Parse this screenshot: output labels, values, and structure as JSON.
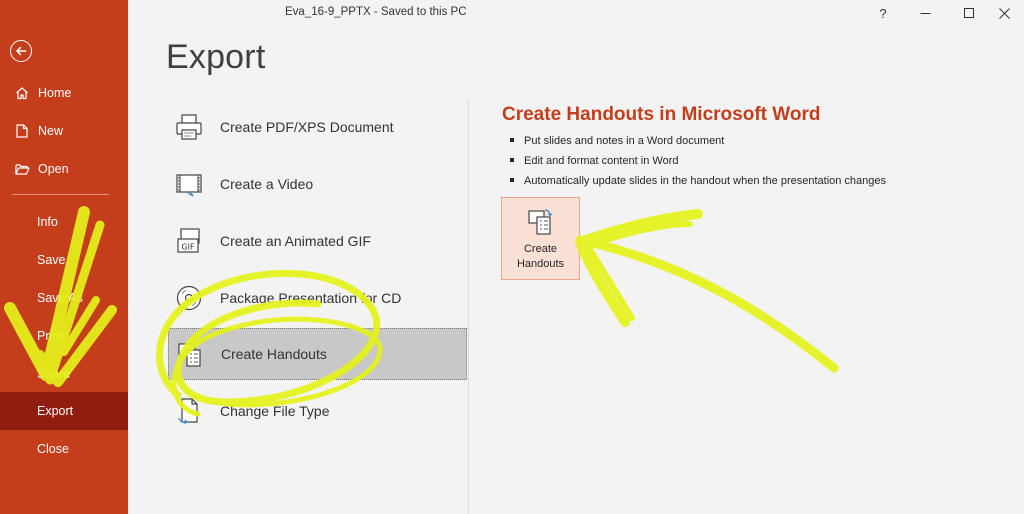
{
  "window": {
    "title": "Eva_16-9_PPTX  -  Saved to this PC",
    "help": "?",
    "minimize": "—",
    "maximize": "☐",
    "close": "✕"
  },
  "sidebar": {
    "back_icon": "back-arrow-icon",
    "items": [
      {
        "label": "Home",
        "icon": "home-icon"
      },
      {
        "label": "New",
        "icon": "new-document-icon"
      },
      {
        "label": "Open",
        "icon": "open-folder-icon"
      },
      {
        "label": "Info"
      },
      {
        "label": "Save"
      },
      {
        "label": "Save As"
      },
      {
        "label": "Print"
      },
      {
        "label": "Share"
      },
      {
        "label": "Export"
      },
      {
        "label": "Close"
      }
    ],
    "active": "Export",
    "bg_color": "#c43e1c",
    "active_color": "#8f1d10"
  },
  "page": {
    "title": "Export"
  },
  "export_options": [
    {
      "label": "Create PDF/XPS Document",
      "icon": "pdf-xps-icon"
    },
    {
      "label": "Create a Video",
      "icon": "video-icon"
    },
    {
      "label": "Create an Animated GIF",
      "icon": "gif-icon"
    },
    {
      "label": "Package Presentation for CD",
      "icon": "cd-icon"
    },
    {
      "label": "Create Handouts",
      "icon": "handouts-icon"
    },
    {
      "label": "Change File Type",
      "icon": "file-type-icon"
    }
  ],
  "selected_option": "Create Handouts",
  "detail": {
    "title": "Create Handouts in Microsoft Word",
    "bullets": [
      "Put slides and notes in a Word document",
      "Edit and format content in Word",
      "Automatically update slides in the handout when the presentation changes"
    ],
    "button_label": "Create\nHandouts",
    "button_icon": "create-handouts-icon",
    "accent_color": "#c43e1c"
  },
  "annotation": {
    "color": "#e5f21a"
  }
}
